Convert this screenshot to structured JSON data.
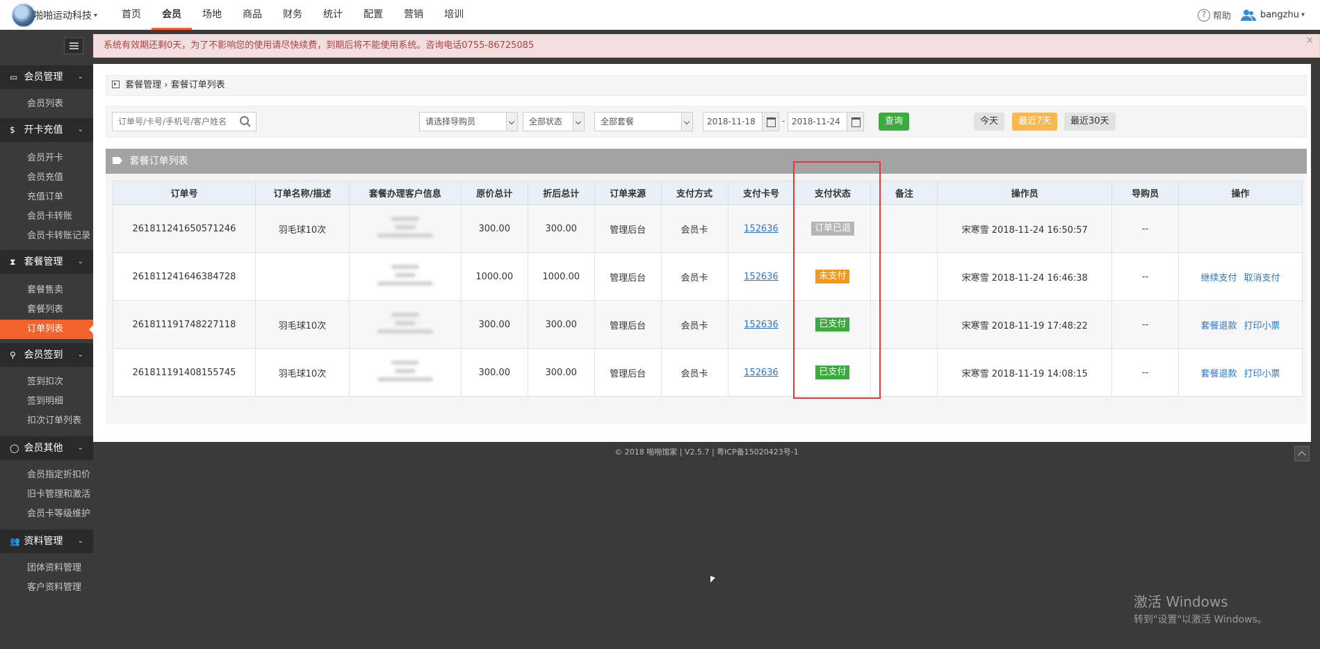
{
  "header": {
    "brand": "啪啪运动科技",
    "nav": [
      "首页",
      "会员",
      "场地",
      "商品",
      "财务",
      "统计",
      "配置",
      "营销",
      "培训"
    ],
    "active_nav": "会员",
    "help": "帮助",
    "user": "bangzhu"
  },
  "sidebar": {
    "groups": [
      {
        "label": "会员管理",
        "icon": "id-card-icon",
        "items": [
          "会员列表"
        ]
      },
      {
        "label": "开卡充值",
        "icon": "dollar-icon",
        "items": [
          "会员开卡",
          "会员充值",
          "充值订单",
          "会员卡转账",
          "会员卡转账记录"
        ]
      },
      {
        "label": "套餐管理",
        "icon": "hourglass-icon",
        "items": [
          "套餐售卖",
          "套餐列表",
          "订单列表"
        ]
      },
      {
        "label": "会员签到",
        "icon": "map-pin-icon",
        "items": [
          "签到扣次",
          "签到明细",
          "扣次订单列表"
        ]
      },
      {
        "label": "会员其他",
        "icon": "circle-icon",
        "items": [
          "会员指定折扣价",
          "旧卡管理和激活",
          "会员卡等级维护"
        ]
      },
      {
        "label": "资料管理",
        "icon": "users-icon",
        "items": [
          "团体资料管理",
          "客户资料管理"
        ]
      }
    ],
    "active_item": "订单列表"
  },
  "notice": "系统有效期还剩0天，为了不影响您的使用请尽快续费，到期后将不能使用系统。咨询电话0755-86725085",
  "breadcrumb": {
    "parent": "套餐管理",
    "sep": "›",
    "current": "套餐订单列表"
  },
  "filters": {
    "search_placeholder": "订单号/卡号/手机号/客户姓名",
    "guide_select": "请选择导购员",
    "status_select": "全部状态",
    "package_select": "全部套餐",
    "date_from": "2018-11-18",
    "date_sep": "-",
    "date_to": "2018-11-24",
    "query_btn": "查询",
    "today_btn": "今天",
    "last7_btn": "最近7天",
    "last30_btn": "最近30天"
  },
  "list": {
    "title": "套餐订单列表",
    "columns": [
      "订单号",
      "订单名称/描述",
      "套餐办理客户信息",
      "原价总计",
      "折后总计",
      "订单来源",
      "支付方式",
      "支付卡号",
      "支付状态",
      "备注",
      "操作员",
      "导购员",
      "操作"
    ],
    "rows": [
      {
        "order_no": "261811241650571246",
        "name": "羽毛球10次",
        "orig": "300.00",
        "disc": "300.00",
        "source": "管理后台",
        "pay_method": "会员卡",
        "card": "152636",
        "status": "订单已退",
        "status_color": "#b5b5b5",
        "remark": "",
        "operator": "宋寒雪 2018-11-24 16:50:57",
        "guide": "--",
        "actions": []
      },
      {
        "order_no": "261811241646384728",
        "name": "",
        "orig": "1000.00",
        "disc": "1000.00",
        "source": "管理后台",
        "pay_method": "会员卡",
        "card": "152636",
        "status": "未支付",
        "status_color": "#f29a1c",
        "remark": "",
        "operator": "宋寒雪 2018-11-24 16:46:38",
        "guide": "--",
        "actions": [
          "继续支付",
          "取消支付"
        ]
      },
      {
        "order_no": "261811191748227118",
        "name": "羽毛球10次",
        "orig": "300.00",
        "disc": "300.00",
        "source": "管理后台",
        "pay_method": "会员卡",
        "card": "152636",
        "status": "已支付",
        "status_color": "#3aac3b",
        "remark": "",
        "operator": "宋寒雪 2018-11-19 17:48:22",
        "guide": "--",
        "actions": [
          "套餐退款",
          "打印小票"
        ]
      },
      {
        "order_no": "261811191408155745",
        "name": "羽毛球10次",
        "orig": "300.00",
        "disc": "300.00",
        "source": "管理后台",
        "pay_method": "会员卡",
        "card": "152636",
        "status": "已支付",
        "status_color": "#3aac3b",
        "remark": "",
        "operator": "宋寒雪 2018-11-19 14:08:15",
        "guide": "--",
        "actions": [
          "套餐退款",
          "打印小票"
        ]
      }
    ]
  },
  "footer": "© 2018 啪啪馆家 | V2.5.7 | 粤ICP备15020423号-1",
  "watermark": {
    "title": "激活 Windows",
    "sub": "转到\"设置\"以激活 Windows。"
  },
  "colors": {
    "accent": "#f4622d",
    "green": "#3aac3b",
    "highlight": "#e03b3b"
  }
}
